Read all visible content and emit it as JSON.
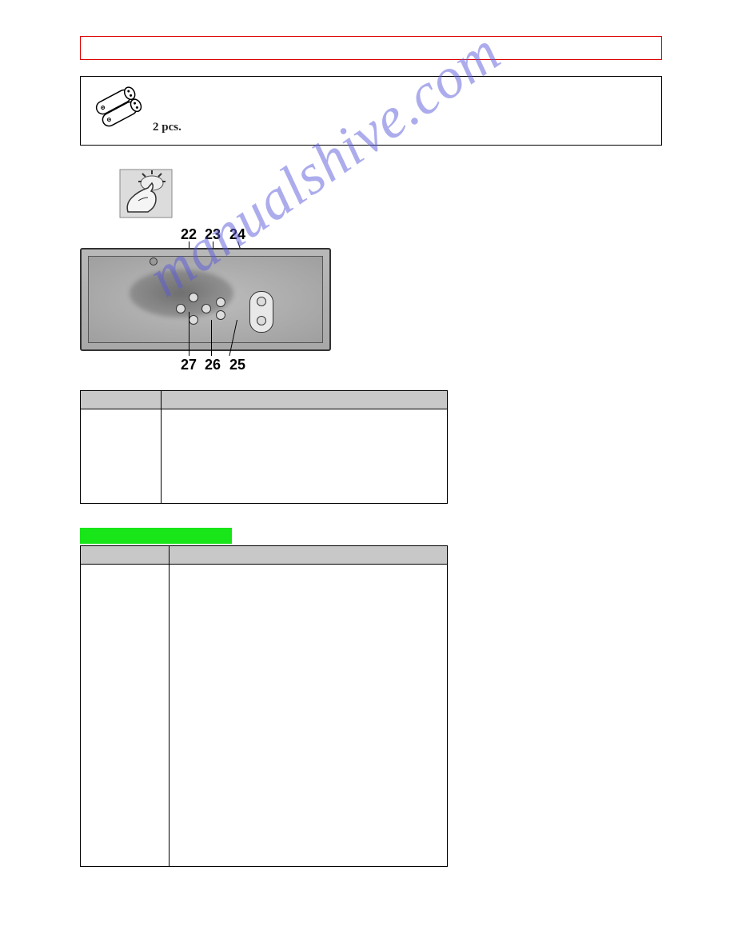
{
  "parts": {
    "qty_label": "2 pcs."
  },
  "remote": {
    "top_numbers": [
      "22",
      "23",
      "24"
    ],
    "bottom_numbers": [
      "27",
      "26",
      "25"
    ]
  },
  "watermark": "manualshive.com"
}
